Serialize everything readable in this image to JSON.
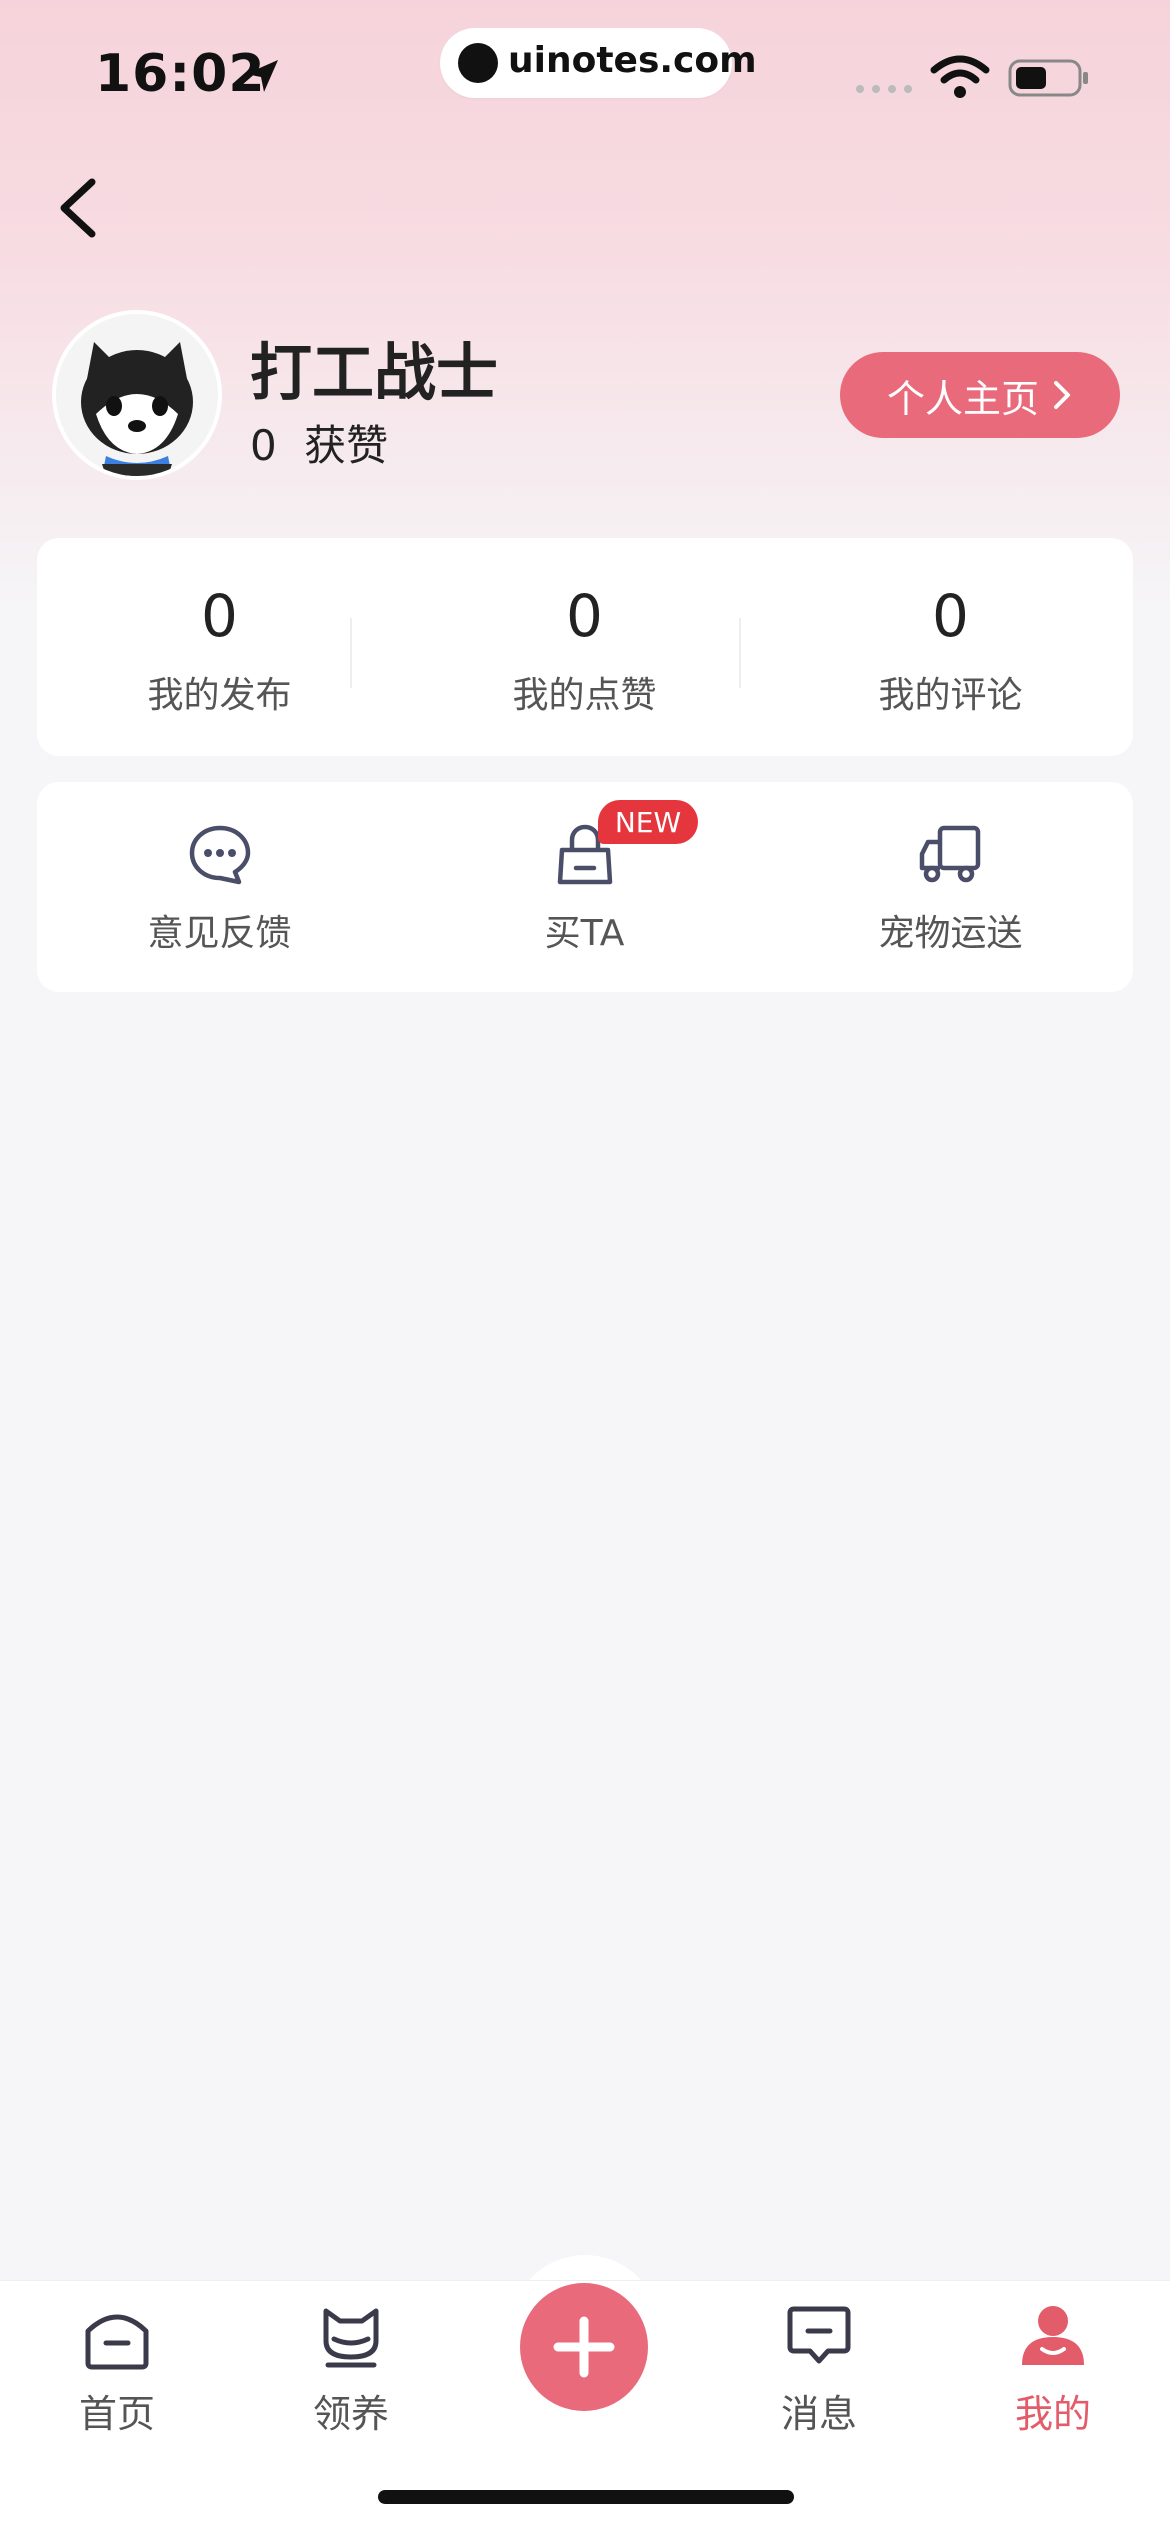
{
  "status_bar": {
    "time": "16:02",
    "url": "uinotes.com"
  },
  "profile": {
    "username": "打工战士",
    "likes_count": "0",
    "likes_label": "获赞",
    "homepage_button": "个人主页"
  },
  "stats": [
    {
      "value": "0",
      "label": "我的发布"
    },
    {
      "value": "0",
      "label": "我的点赞"
    },
    {
      "value": "0",
      "label": "我的评论"
    }
  ],
  "tools": [
    {
      "label": "意见反馈",
      "icon": "chat-bubble-icon"
    },
    {
      "label": "买TA",
      "icon": "shopping-bag-icon",
      "badge": "NEW"
    },
    {
      "label": "宠物运送",
      "icon": "truck-icon"
    }
  ],
  "tabbar": [
    {
      "label": "首页",
      "icon": "home-icon"
    },
    {
      "label": "领养",
      "icon": "cat-icon"
    },
    {
      "label": "",
      "icon": "plus-icon"
    },
    {
      "label": "消息",
      "icon": "message-icon"
    },
    {
      "label": "我的",
      "icon": "user-icon",
      "active": true
    }
  ],
  "colors": {
    "accent": "#e96a7a",
    "badge": "#e5353d",
    "active_tab": "#e25c6a",
    "background": "#f6f6f8"
  }
}
